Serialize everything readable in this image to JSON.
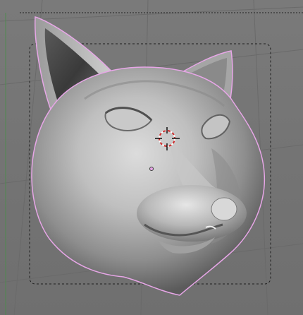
{
  "viewport": {
    "background": "#737373",
    "grid_color": "#686868",
    "selection_outline_color": "#e7a6e7",
    "border_style": "dashed",
    "cursor_color": "#cf2b2b"
  },
  "scene": {
    "object": "cat-head-sculpt",
    "shading": "solid-gray",
    "selected": true
  },
  "icons": {
    "cursor": "3d-cursor-icon",
    "origin": "object-origin-icon"
  }
}
